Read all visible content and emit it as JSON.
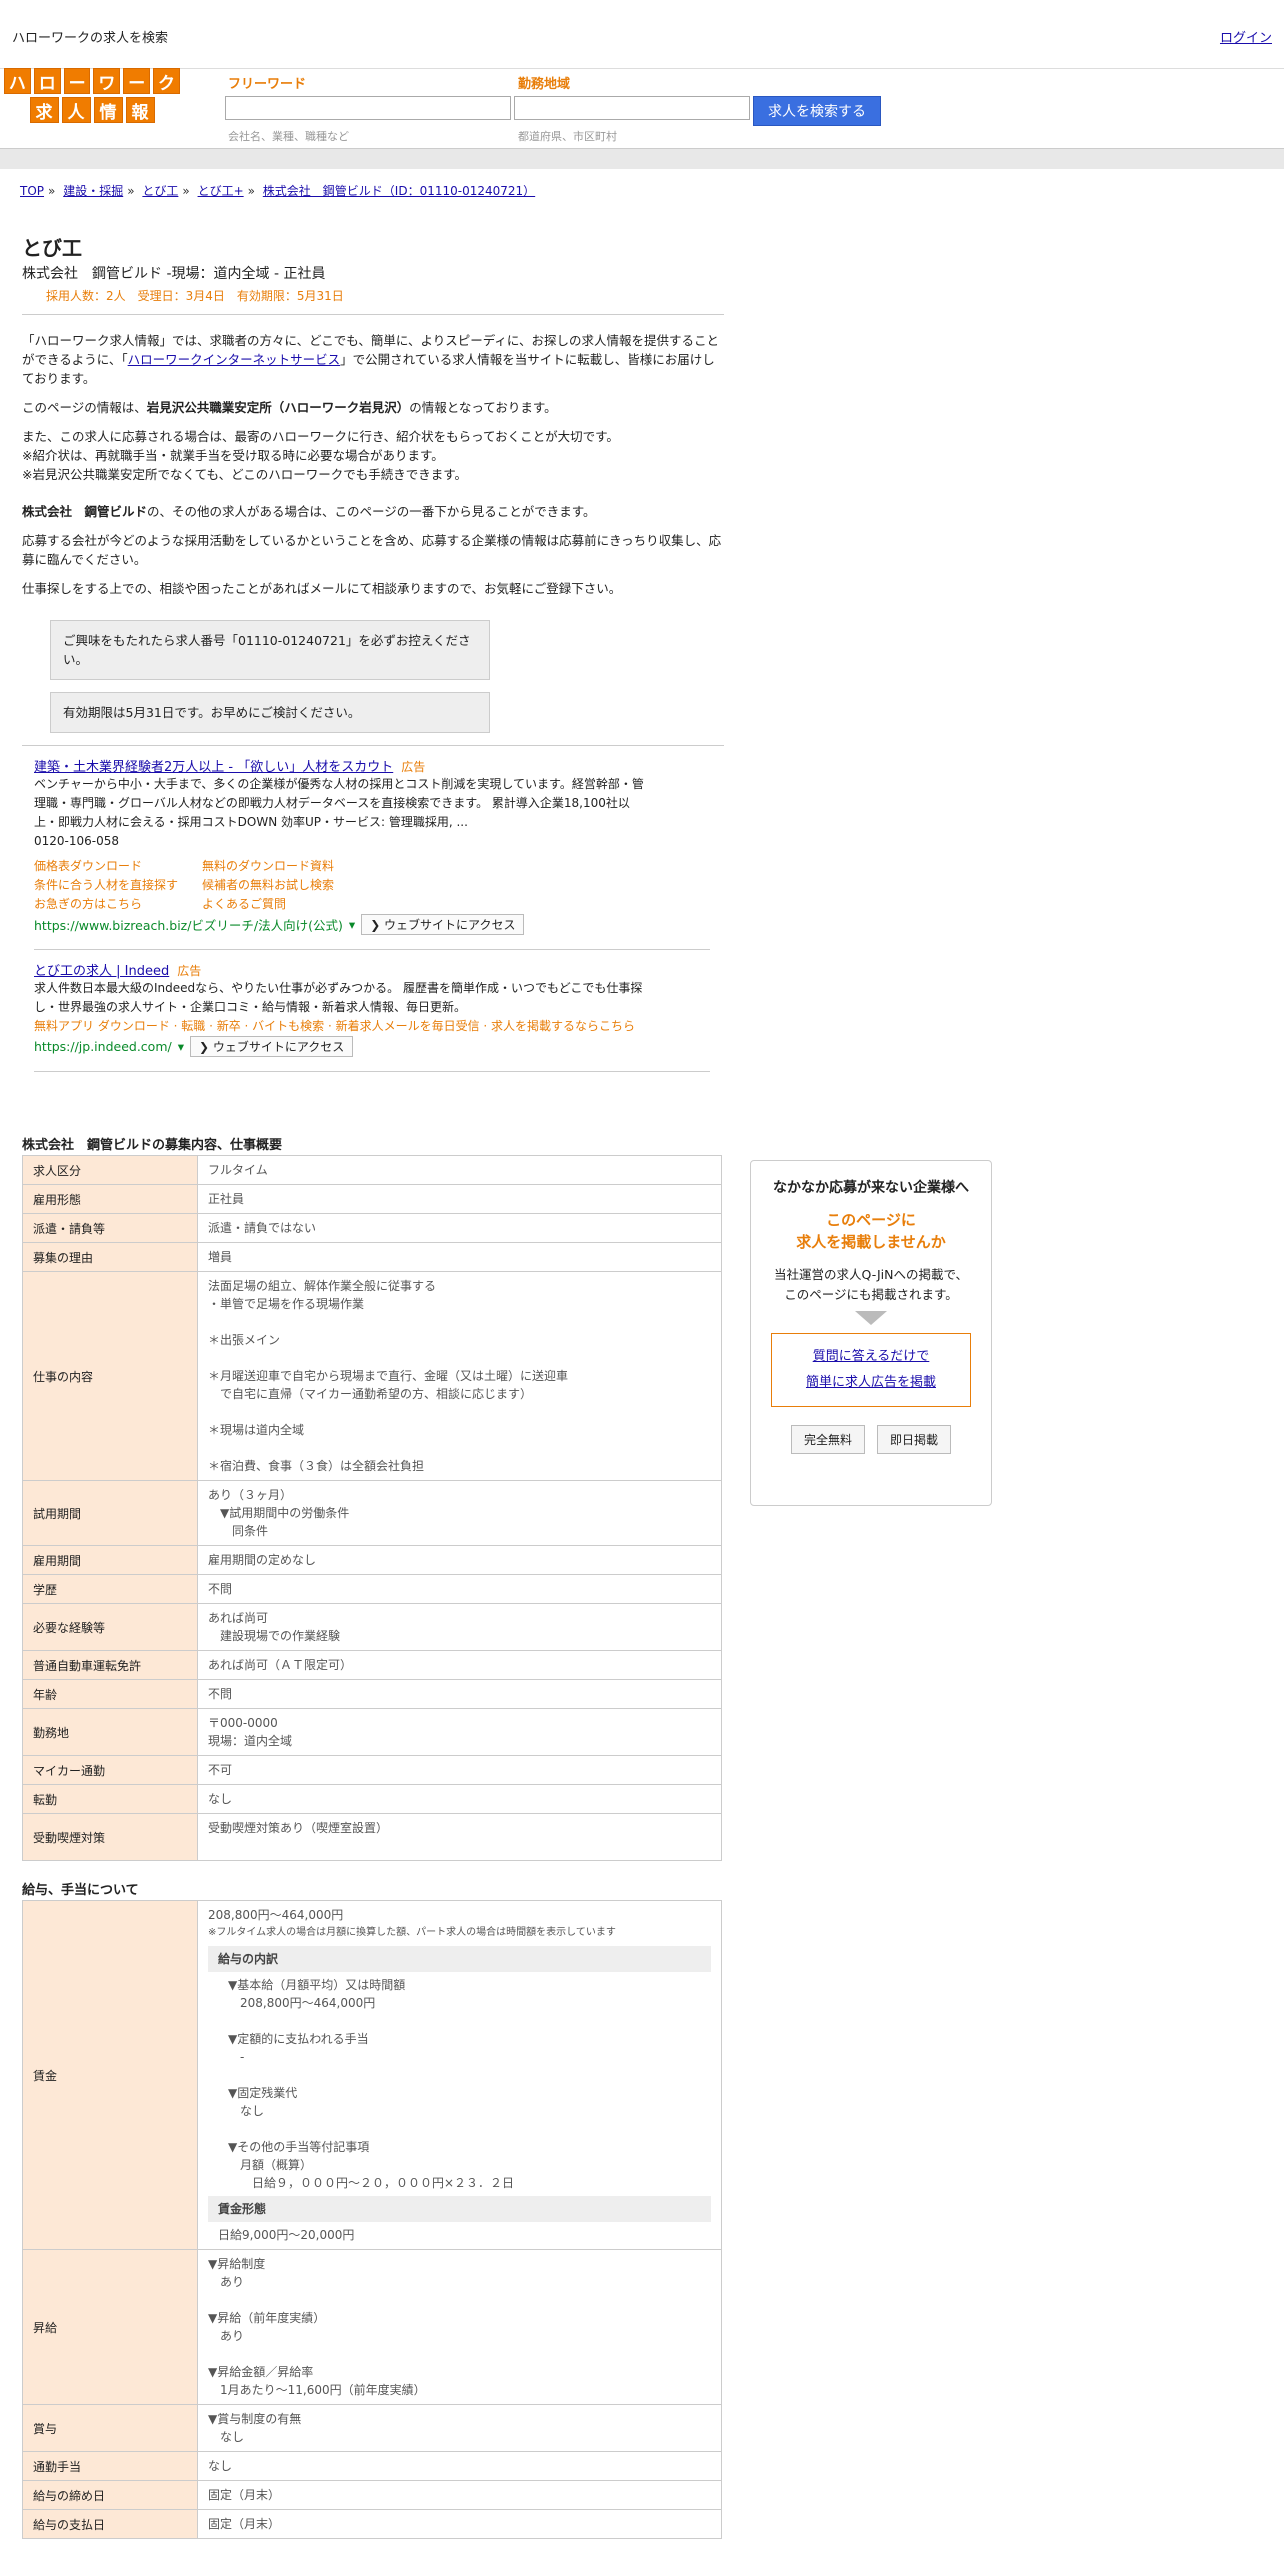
{
  "topbar": {
    "site_title": "ハローワークの求人を検索",
    "login": "ログイン"
  },
  "logo": {
    "row1": [
      "ハ",
      "ロ",
      "ー",
      "ワ",
      "ー",
      "ク"
    ],
    "row2": [
      "求",
      "人",
      "情",
      "報"
    ]
  },
  "search": {
    "freeword_label": "フリーワード",
    "freeword_placeholder": "",
    "freeword_hint": "会社名、業種、職種など",
    "area_label": "勤務地域",
    "area_placeholder": "",
    "area_hint": "都道府県、市区町村",
    "button": "求人を検索する"
  },
  "breadcrumb": [
    "TOP",
    "建設・採掘",
    "とび工",
    "とび工+",
    "株式会社　鋼管ビルド（ID：01110-01240721）"
  ],
  "job": {
    "title": "とび工",
    "subtitle": "株式会社　鋼管ビルド -現場：道内全域 - 正社員",
    "meta": "採用人数：2人　受理日：3月4日　有効期限：5月31日"
  },
  "intro": {
    "p1a": "「ハローワーク求人情報」では、求職者の方々に、どこでも、簡単に、よりスピーディに、お探しの求人情報を提供することができるように、「",
    "p1link": "ハローワークインターネットサービス",
    "p1b": "」で公開されている求人情報を当サイトに転載し、皆様にお届けしております。",
    "p2a": "このページの情報は、",
    "p2b": "岩見沢公共職業安定所（ハローワーク岩見沢）",
    "p2c": "の情報となっております。",
    "p3l1": "また、この求人に応募される場合は、最寄のハローワークに行き、紹介状をもらっておくことが大切です。",
    "p3l2": "※紹介状は、再就職手当・就業手当を受け取る時に必要な場合があります。",
    "p3l3": "※岩見沢公共職業安定所でなくても、どこのハローワークでも手続きできます。",
    "p4a": "株式会社　鋼管ビルド",
    "p4b": "の、その他の求人がある場合は、このページの一番下から見ることができます。",
    "p5": "応募する会社が今どのような採用活動をしているかということを含め、応募する企業様の情報は応募前にきっちり収集し、応募に臨んでください。",
    "p6": "仕事探しをする上での、相談や困ったことがあればメールにて相談承りますので、お気軽にご登録下さい。",
    "notice1": "ご興味をもたれたら求人番号「01110-01240721」を必ずお控えください。",
    "notice2": "有効期限は5月31日です。お早めにご検討ください。"
  },
  "ads": [
    {
      "title": "建築・土木業界経験者2万人以上 - 「欲しい」人材をスカウト",
      "badge": "広告",
      "desc": "ベンチャーから中小・大手まで、多くの企業様が優秀な人材の採用とコスト削減を実現しています。経営幹部・管理職・専門職・グローバル人材などの即戦力人材データベースを直接検索できます。 累計導入企業18,100社以上・即戦力人材に会える・採用コストDOWN 効率UP・サービス: 管理職採用, ...",
      "phone": "0120-106-058",
      "links": [
        "価格表ダウンロード",
        "無料のダウンロード資料",
        "条件に合う人材を直接探す",
        "候補者の無料お試し検索",
        "お急ぎの方はこちら",
        "よくあるご質問"
      ],
      "url": "https://www.bizreach.biz/ビズリーチ/法人向け(公式)",
      "button": "❯ ウェブサイトにアクセス"
    },
    {
      "title": "とび工の求人 | Indeed",
      "badge": "広告",
      "desc1": "求人件数日本最大級のIndeedなら、やりたい仕事が必ずみつかる。 履歴書を簡単作成・いつでもどこでも仕事探し・世界最強の求人サイト・企業口コミ・給与情報・新着求人情報、毎日更新。",
      "links": "無料アプリ ダウンロード · 転職 · 新卒 · バイトも検索 · 新着求人メールを毎日受信 · 求人を掲載するならこちら",
      "url": "https://jp.indeed.com/",
      "button": "❯ ウェブサイトにアクセス"
    }
  ],
  "details": {
    "title": "株式会社　鋼管ビルドの募集内容、仕事概要",
    "rows": [
      {
        "k": "求人区分",
        "v": [
          "フルタイム"
        ]
      },
      {
        "k": "雇用形態",
        "v": [
          "正社員"
        ]
      },
      {
        "k": "派遣・請負等",
        "v": [
          "派遣・請負ではない"
        ]
      },
      {
        "k": "募集の理由",
        "v": [
          "増員"
        ]
      },
      {
        "k": "仕事の内容",
        "v": [
          "法面足場の組立、解体作業全般に従事する",
          "・単管で足場を作る現場作業",
          "",
          "＊出張メイン",
          "",
          "＊月曜送迎車で自宅から現場まで直行、金曜（又は土曜）に送迎車",
          "　で自宅に直帰（マイカー通勤希望の方、相談に応じます）",
          "",
          "＊現場は道内全域",
          "",
          "＊宿泊費、食事（３食）は全額会社負担"
        ]
      },
      {
        "k": "試用期間",
        "v": [
          "あり（３ヶ月）",
          "　▼試用期間中の労働条件",
          "　　同条件"
        ]
      },
      {
        "k": "雇用期間",
        "v": [
          "雇用期間の定めなし"
        ]
      },
      {
        "k": "学歴",
        "v": [
          "不問"
        ]
      },
      {
        "k": "必要な経験等",
        "v": [
          "あれば尚可",
          "　建設現場での作業経験"
        ]
      },
      {
        "k": "普通自動車運転免許",
        "v": [
          "あれば尚可（ＡＴ限定可）"
        ]
      },
      {
        "k": "年齢",
        "v": [
          "不問"
        ]
      },
      {
        "k": "勤務地",
        "v": [
          "〒000-0000",
          "現場：道内全域"
        ]
      },
      {
        "k": "マイカー通勤",
        "v": [
          "不可"
        ]
      },
      {
        "k": "転勤",
        "v": [
          "なし"
        ]
      },
      {
        "k": "受動喫煙対策",
        "v": [
          "受動喫煙対策あり（喫煙室設置）",
          ""
        ]
      }
    ]
  },
  "salary": {
    "title": "給与、手当について",
    "wage_label": "賃金",
    "wage_range": "208,800円〜464,000円",
    "wage_note": "※フルタイム求人の場合は月額に換算した額、パート求人の場合は時間額を表示しています",
    "breakdown_title": "給与の内訳",
    "breakdown": [
      "▼基本給（月額平均）又は時間額",
      "　208,800円〜464,000円",
      "",
      "▼定額的に支払われる手当",
      "　-",
      "",
      "▼固定残業代",
      "　なし",
      "",
      "▼その他の手当等付記事項",
      "　月額（概算）",
      "　　日給９，０００円～２０，０００円×２３．２日"
    ],
    "type_title": "賃金形態",
    "type_value": "日給9,000円〜20,000円",
    "rows": [
      {
        "k": "昇給",
        "v": [
          "▼昇給制度",
          "　あり",
          "",
          "▼昇給（前年度実績）",
          "　あり",
          "",
          "▼昇給金額／昇給率",
          "　1月あたり〜11,600円（前年度実績）"
        ]
      },
      {
        "k": "賞与",
        "v": [
          "▼賞与制度の有無",
          "　なし"
        ]
      },
      {
        "k": "通勤手当",
        "v": [
          "なし"
        ]
      },
      {
        "k": "給与の締め日",
        "v": [
          "固定（月末）"
        ]
      },
      {
        "k": "給与の支払日",
        "v": [
          "固定（月末）"
        ]
      }
    ]
  },
  "sidebar": {
    "title": "なかなか応募が来ない企業様へ",
    "orange1": "このページに",
    "orange2": "求人を掲載しませんか",
    "text1": "当社運営の求人Q-JiNへの掲載で、",
    "text2": "このページにも掲載されます。",
    "link1": "質問に答えるだけで",
    "link2": "簡単に求人広告を掲載",
    "btn1": "完全無料",
    "btn2": "即日掲載"
  }
}
